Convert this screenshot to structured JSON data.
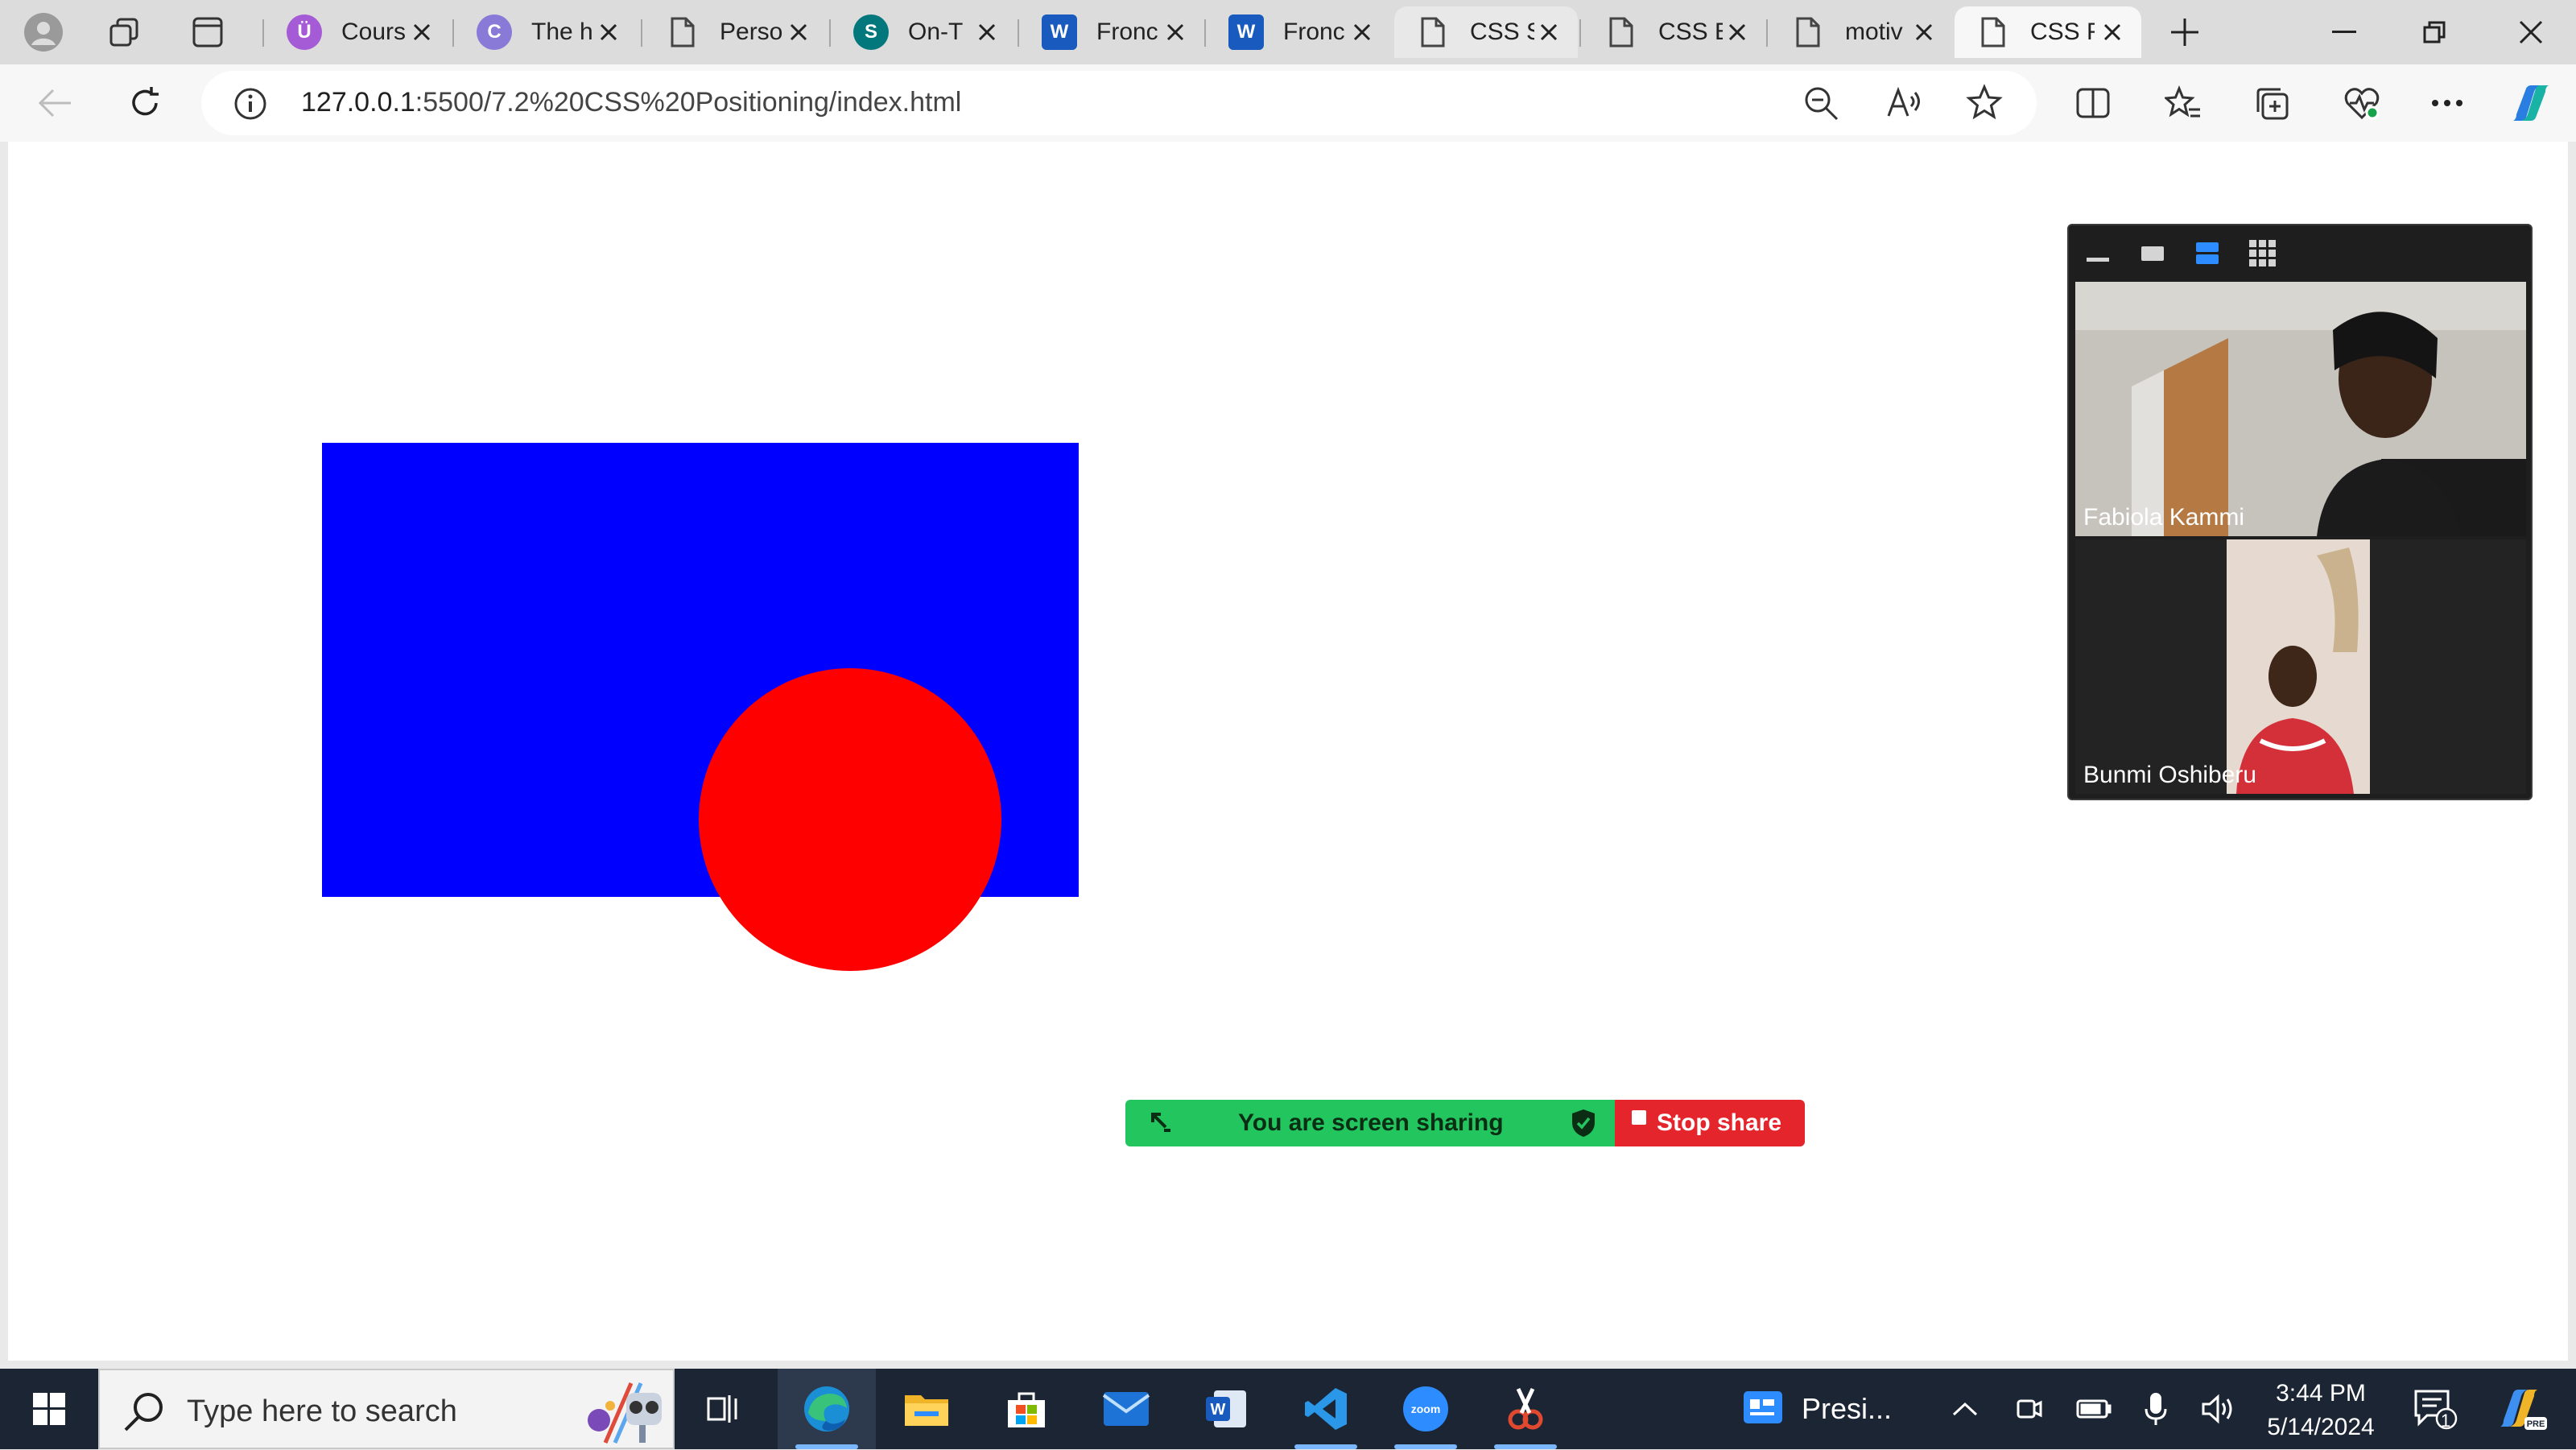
{
  "browser": {
    "tabs": [
      {
        "title": "Cours",
        "favicon": "udemy",
        "color": "#a65bd6"
      },
      {
        "title": "The h",
        "favicon": "c-logo",
        "color": "#8a7ad8"
      },
      {
        "title": "Perso",
        "favicon": "document",
        "color": "#555555"
      },
      {
        "title": "On-T",
        "favicon": "sharepoint",
        "color": "#03787c"
      },
      {
        "title": "Fronc",
        "favicon": "word",
        "color": "#185abd"
      },
      {
        "title": "Fronc",
        "favicon": "word",
        "color": "#185abd"
      },
      {
        "title": "CSS S",
        "favicon": "document",
        "color": "#555555"
      },
      {
        "title": "CSS E",
        "favicon": "document",
        "color": "#555555"
      },
      {
        "title": "motiv",
        "favicon": "document",
        "color": "#555555"
      },
      {
        "title": "CSS F",
        "favicon": "document",
        "color": "#555555"
      }
    ],
    "active_tab_index": 9,
    "address": {
      "host": "127.0.0.1",
      "path": ":5500/7.2%20CSS%20Positioning/index.html"
    }
  },
  "page": {
    "blue_box_color": "#0000ff",
    "red_circle_color": "#ff0000"
  },
  "zoom": {
    "participants": [
      {
        "name": "Fabiola Kammi"
      },
      {
        "name": "Bunmi Oshiberu"
      }
    ],
    "share_banner": {
      "status": "You are screen sharing",
      "stop_label": "Stop share"
    }
  },
  "taskbar": {
    "search_placeholder": "Type here to search",
    "pinned": [
      "task-view",
      "edge",
      "file-explorer",
      "microsoft-store",
      "mail",
      "word",
      "vs-code",
      "zoom",
      "snipping-tool"
    ],
    "running_window": {
      "label": "Presi..."
    },
    "clock": {
      "time": "3:44 PM",
      "date": "5/14/2024"
    },
    "notification_count": "1"
  }
}
